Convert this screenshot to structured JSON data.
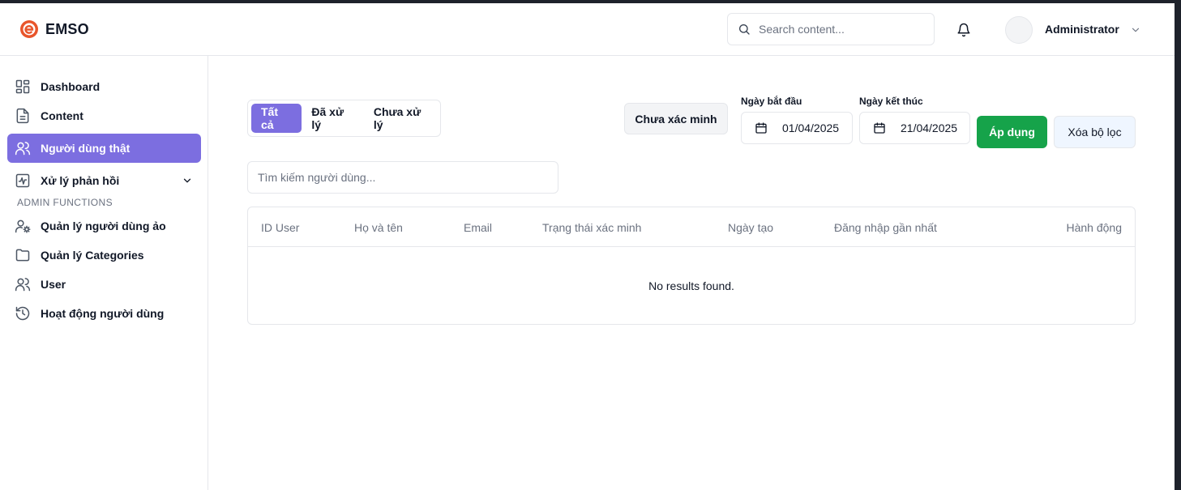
{
  "header": {
    "brand": "EMSO",
    "search_placeholder": "Search content...",
    "user_name": "Administrator"
  },
  "sidebar": {
    "items": [
      {
        "label": "Dashboard",
        "icon": "dashboard-icon"
      },
      {
        "label": "Content",
        "icon": "document-icon"
      },
      {
        "label": "Người dùng thật",
        "icon": "users-icon",
        "active": true
      },
      {
        "label": "Xử lý phản hồi",
        "icon": "activity-icon",
        "expandable": true
      }
    ],
    "section_label": "ADMIN FUNCTIONS",
    "admin_items": [
      {
        "label": "Quản lý người dùng ảo",
        "icon": "user-cog-icon"
      },
      {
        "label": "Quản lý Categories",
        "icon": "folder-icon"
      },
      {
        "label": "User",
        "icon": "users-icon"
      },
      {
        "label": "Hoạt động người dùng",
        "icon": "history-icon"
      }
    ]
  },
  "filters": {
    "tabs": [
      {
        "label": "Tất cả",
        "active": true
      },
      {
        "label": "Đã xử lý"
      },
      {
        "label": "Chưa xử lý"
      }
    ],
    "unverified_label": "Chưa xác minh",
    "start_date_label": "Ngày bắt đầu",
    "start_date_value": "01/04/2025",
    "end_date_label": "Ngày kết thúc",
    "end_date_value": "21/04/2025",
    "apply_label": "Áp dụng",
    "clear_label": "Xóa bộ lọc",
    "user_search_placeholder": "Tìm kiếm người dùng..."
  },
  "table": {
    "columns": [
      "ID User",
      "Họ và tên",
      "Email",
      "Trạng thái xác minh",
      "Ngày tạo",
      "Đăng nhập gần nhất",
      "Hành động"
    ],
    "rows": [],
    "empty_message": "No results found."
  },
  "colors": {
    "accent": "#7c6ee0",
    "success": "#16a34a",
    "brand": "#e8552b"
  }
}
